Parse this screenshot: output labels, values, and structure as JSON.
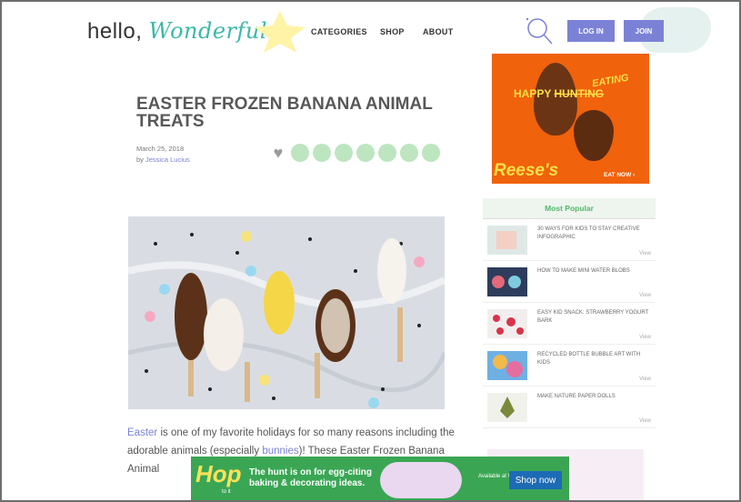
{
  "header": {
    "logo_prefix": "hello,",
    "logo_accent": "Wonderful",
    "nav": [
      "CATEGORIES",
      "SHOP",
      "ABOUT"
    ],
    "login_label": "LOG IN",
    "join_label": "JOIN",
    "accent_color": "#7b82d6"
  },
  "article": {
    "title": "EASTER FROZEN BANANA ANIMAL TREATS",
    "date": "March 25, 2018",
    "by": "by",
    "author": "Jessica Lucius",
    "body": {
      "link1": "Easter",
      "text1": " is one of my favorite holidays for so many reasons including the adorable animals (especially ",
      "link2": "bunnies",
      "text2": ")! These Easter Frozen Banana Animal"
    }
  },
  "ad": {
    "happy": "HAPPY ",
    "hunting": "HUNTING",
    "eating": "EATING",
    "brand": "Reese's",
    "cta": "EAT NOW ›"
  },
  "sidebar": {
    "popular_title": "Most Popular",
    "items": [
      {
        "title": "30 WAYS FOR KIDS TO STAY CREATIVE INFOGRAPHIC",
        "view": "View"
      },
      {
        "title": "HOW TO MAKE MINI WATER BLOBS",
        "view": "View"
      },
      {
        "title": "EASY KID SNACK: STRAWBERRY YOGURT BARK",
        "view": "View"
      },
      {
        "title": "RECYCLED BOTTLE BUBBLE ART WITH KIDS",
        "view": "View"
      },
      {
        "title": "MAKE NATURE PAPER DOLLS",
        "view": "View"
      }
    ]
  },
  "banner": {
    "hop": "Hop",
    "hop_tag": "to it",
    "text": "The hunt is on for egg-citing baking & decorating ideas.",
    "walmart": "Available at Walmart",
    "shop_label": "Shop now"
  }
}
